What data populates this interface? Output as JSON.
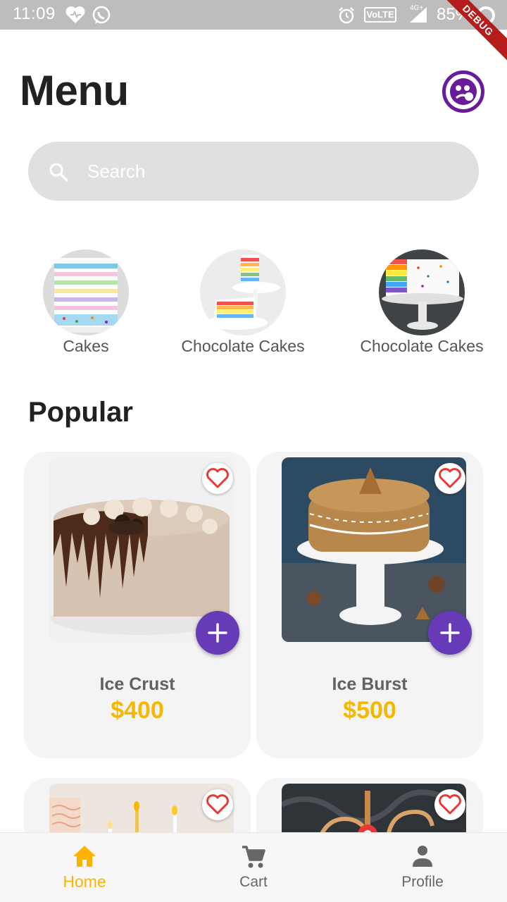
{
  "status_bar": {
    "time": "11:09",
    "volte": "VoLTE",
    "network": "4G+",
    "battery": "85%",
    "debug_banner": "DEBUG",
    "icons": [
      "heart-icon",
      "whatsapp-icon",
      "alarm-icon",
      "signal-icon",
      "battery-icon"
    ]
  },
  "header": {
    "title": "Menu",
    "avatar_icon": "profile-avatar-icon"
  },
  "search": {
    "placeholder": "Search",
    "value": ""
  },
  "categories": [
    {
      "label": "Cakes"
    },
    {
      "label": "Chocolate Cakes"
    },
    {
      "label": "Chocolate Cakes"
    }
  ],
  "popular": {
    "title": "Popular",
    "products": [
      {
        "name": "Ice Crust",
        "price": "$400"
      },
      {
        "name": "Ice Burst",
        "price": "$500"
      },
      {
        "name": "",
        "price": ""
      },
      {
        "name": "",
        "price": ""
      }
    ]
  },
  "bottom_nav": {
    "items": [
      {
        "label": "Home",
        "icon": "home-icon",
        "active": true
      },
      {
        "label": "Cart",
        "icon": "cart-icon",
        "active": false
      },
      {
        "label": "Profile",
        "icon": "person-icon",
        "active": false
      }
    ]
  },
  "colors": {
    "accent_purple": "#673ab7",
    "price_yellow": "#f5b800",
    "active_nav": "#ffb300",
    "favorite_red": "#e53935",
    "card_bg": "#f4f4f4",
    "status_bar": "#bdbdbd"
  }
}
